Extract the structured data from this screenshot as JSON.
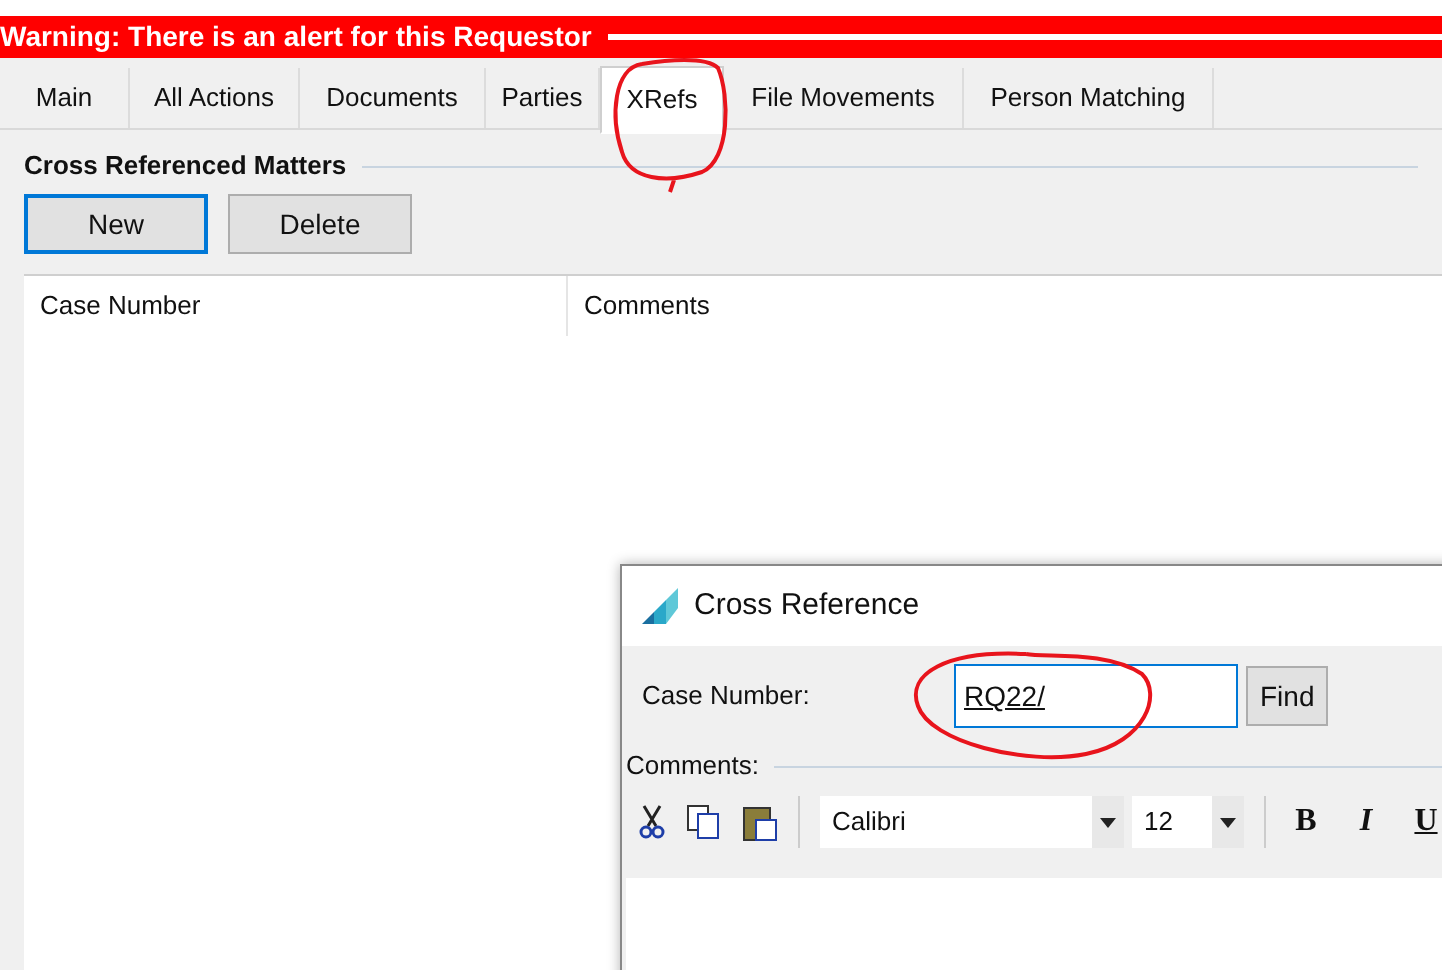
{
  "warning": {
    "text": "Warning: There is an alert for this Requestor"
  },
  "tabs": [
    {
      "label": "Main",
      "selected": false
    },
    {
      "label": "All Actions",
      "selected": false
    },
    {
      "label": "Documents",
      "selected": false
    },
    {
      "label": "Parties",
      "selected": false
    },
    {
      "label": "XRefs",
      "selected": true
    },
    {
      "label": "File Movements",
      "selected": false
    },
    {
      "label": "Person Matching",
      "selected": false
    }
  ],
  "section": {
    "title": "Cross Referenced Matters",
    "buttons": [
      {
        "label": "New",
        "focused": true
      },
      {
        "label": "Delete",
        "focused": false
      }
    ]
  },
  "table": {
    "columns": [
      "Case Number",
      "Comments"
    ]
  },
  "dialog": {
    "title": "Cross Reference",
    "case_number_label": "Case Number:",
    "case_number_value": "RQ22/",
    "find_button": "Find",
    "comments_label": "Comments:",
    "font": "Calibri",
    "size": "12",
    "format_buttons": [
      "B",
      "I",
      "U"
    ]
  }
}
